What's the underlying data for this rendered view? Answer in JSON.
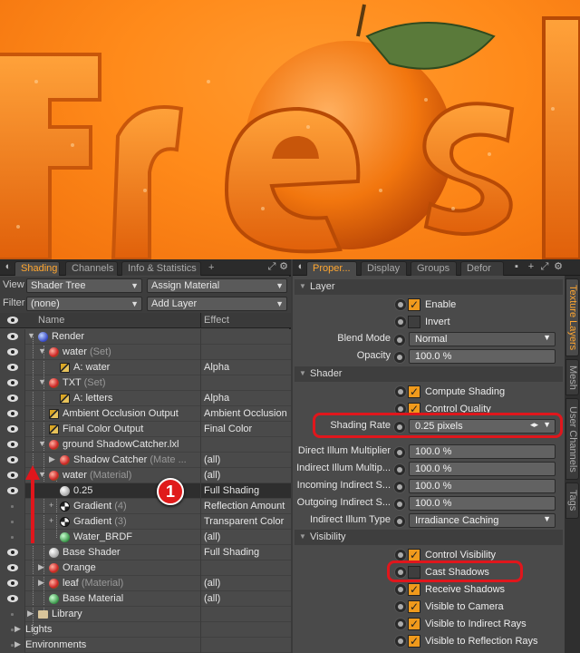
{
  "colors": {
    "accent": "#ffa630",
    "highlight": "#e0161c",
    "checkbox": "#f09a1c"
  },
  "viewport": {
    "subject": "3D render of orange letters with an orange and leaf"
  },
  "left_panel": {
    "tabs": [
      "Shading",
      "Channels",
      "Info & Statistics",
      "+"
    ],
    "view_label": "View",
    "view_value": "Shader Tree",
    "assign_material": "Assign Material",
    "filter_label": "Filter",
    "filter_value": "(none)",
    "add_layer": "Add Layer",
    "col_name": "Name",
    "col_effect": "Effect",
    "rows": [
      {
        "name": "Render",
        "sub": "",
        "effect": "",
        "icon": "sphere-blue"
      },
      {
        "name": "water",
        "sub": "(Set)",
        "effect": "",
        "icon": "sphere-red"
      },
      {
        "name": "A: water",
        "sub": "",
        "effect": "Alpha",
        "icon": "img"
      },
      {
        "name": "TXT",
        "sub": "(Set)",
        "effect": "",
        "icon": "sphere-red"
      },
      {
        "name": "A: letters",
        "sub": "",
        "effect": "Alpha",
        "icon": "img"
      },
      {
        "name": "Ambient Occlusion Output",
        "sub": "",
        "effect": "Ambient Occlusion",
        "icon": "img"
      },
      {
        "name": "Final Color Output",
        "sub": "",
        "effect": "Final Color",
        "icon": "img"
      },
      {
        "name": "ground ShadowCatcher.lxl",
        "sub": "",
        "effect": "",
        "icon": "sphere-red"
      },
      {
        "name": "Shadow Catcher",
        "sub": "(Mate ...",
        "effect": "(all)",
        "icon": "sphere-red"
      },
      {
        "name": "water",
        "sub": "(Material)",
        "effect": "(all)",
        "icon": "sphere-red"
      },
      {
        "name": "0.25",
        "sub": "",
        "effect": "Full Shading",
        "icon": "sphere-white"
      },
      {
        "name": "Gradient",
        "sub": "(4)",
        "effect": "Reflection Amount",
        "icon": "check"
      },
      {
        "name": "Gradient",
        "sub": "(3)",
        "effect": "Transparent Color",
        "icon": "check"
      },
      {
        "name": "Water_BRDF",
        "sub": "",
        "effect": "(all)",
        "icon": "sphere-green"
      },
      {
        "name": "Base Shader",
        "sub": "",
        "effect": "Full Shading",
        "icon": "sphere-white"
      },
      {
        "name": "Orange",
        "sub": "",
        "effect": "",
        "icon": "sphere-red"
      },
      {
        "name": "leaf",
        "sub": "(Material)",
        "effect": "(all)",
        "icon": "sphere-red"
      },
      {
        "name": "Base Material",
        "sub": "",
        "effect": "(all)",
        "icon": "sphere-green"
      },
      {
        "name": "Library",
        "sub": "",
        "effect": "",
        "icon": "folder"
      },
      {
        "name": "Lights",
        "sub": "",
        "effect": "",
        "icon": ""
      },
      {
        "name": "Environments",
        "sub": "",
        "effect": "",
        "icon": ""
      }
    ],
    "badge": "1"
  },
  "right_panel": {
    "tabs": [
      "Proper...",
      "Display",
      "Groups",
      "Defor"
    ],
    "vtabs": [
      "Texture Layers",
      "Mesh",
      "User Channels",
      "Tags"
    ],
    "sections": {
      "layer": "Layer",
      "shader": "Shader",
      "visibility": "Visibility"
    },
    "enable": "Enable",
    "invert": "Invert",
    "blend_mode_label": "Blend Mode",
    "blend_mode": "Normal",
    "opacity_label": "Opacity",
    "opacity": "100.0 %",
    "compute_shading": "Compute Shading",
    "control_quality": "Control Quality",
    "shading_rate_label": "Shading Rate",
    "shading_rate": "0.25 pixels",
    "direct_illum_label": "Direct Illum Multiplier",
    "direct_illum": "100.0 %",
    "indirect_illum_label": "Indirect Illum Multip...",
    "indirect_illum": "100.0 %",
    "incoming_label": "Incoming Indirect S...",
    "incoming": "100.0 %",
    "outgoing_label": "Outgoing Indirect S...",
    "outgoing": "100.0 %",
    "indirect_type_label": "Indirect Illum Type",
    "indirect_type": "Irradiance Caching",
    "control_visibility": "Control Visibility",
    "cast_shadows": "Cast Shadows",
    "receive_shadows": "Receive Shadows",
    "visible_camera": "Visible to Camera",
    "visible_indirect": "Visible to Indirect Rays",
    "visible_reflection": "Visible to Reflection Rays"
  }
}
